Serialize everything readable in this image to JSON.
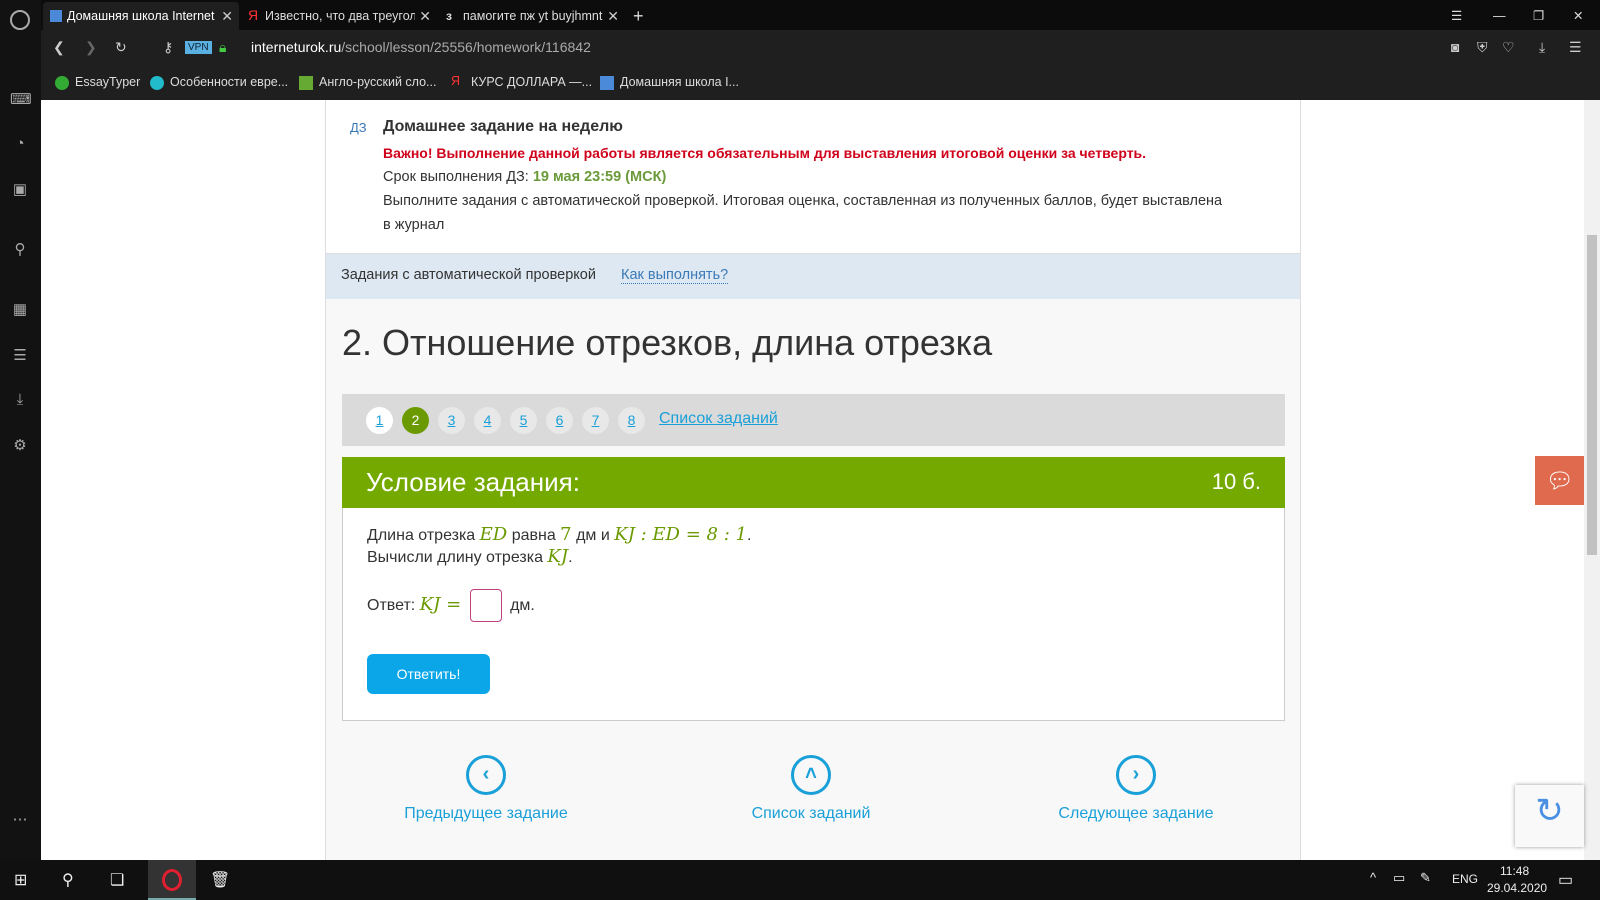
{
  "browser": {
    "tabs": [
      {
        "label": "Домашняя школа Internet"
      },
      {
        "label": "Известно, что два треугол"
      },
      {
        "label": "памогите пж yt buyjhmnt"
      }
    ],
    "vpn": "VPN",
    "url_host": "interneturok.ru",
    "url_path": "/school/lesson/25556/homework/116842",
    "bookmarks": [
      "EssayTyper",
      "Особенности евре...",
      "Англо-русский сло...",
      "КУРС ДОЛЛАРА —...",
      "Домашняя школа I..."
    ]
  },
  "homework": {
    "badge": "ДЗ",
    "title": "Домашнее задание на неделю",
    "warning": "Важно! Выполнение данной работы является обязательным для выставления итоговой оценки за четверть.",
    "deadline_label": "Срок выполнения ДЗ:",
    "deadline_value": "19 мая 23:59 (МСК)",
    "desc_line1": "Выполните задания с автоматической проверкой. Итоговая оценка, составленная из полученных баллов, будет выставлена",
    "desc_line2": "в журнал"
  },
  "band": {
    "label": "Задания с автоматической проверкой",
    "link": "Как выполнять?"
  },
  "lesson_title": "2. Отношение отрезков, длина отрезка",
  "pagination": {
    "pages": [
      "1",
      "2",
      "3",
      "4",
      "5",
      "6",
      "7",
      "8"
    ],
    "current": "2",
    "list_link": "Список заданий"
  },
  "task": {
    "header": "Условие задания:",
    "points": "10 б.",
    "l1a": "Длина отрезка",
    "m1": "ED",
    "l1b": "равна",
    "m2": "7",
    "l1c": "дм и",
    "m3": "KJ : ED = 8 : 1",
    "l2a": "Вычисли длину отрезка",
    "m4": "KJ",
    "answer_label": "Ответ:",
    "answer_math": "KJ =",
    "answer_value": "",
    "unit": "дм.",
    "submit": "Ответить!"
  },
  "nav": {
    "prev": "Предыдущее задание",
    "list": "Список заданий",
    "next": "Следующее задание"
  },
  "taskbar": {
    "lang": "ENG",
    "time": "11:48",
    "date": "29.04.2020"
  }
}
